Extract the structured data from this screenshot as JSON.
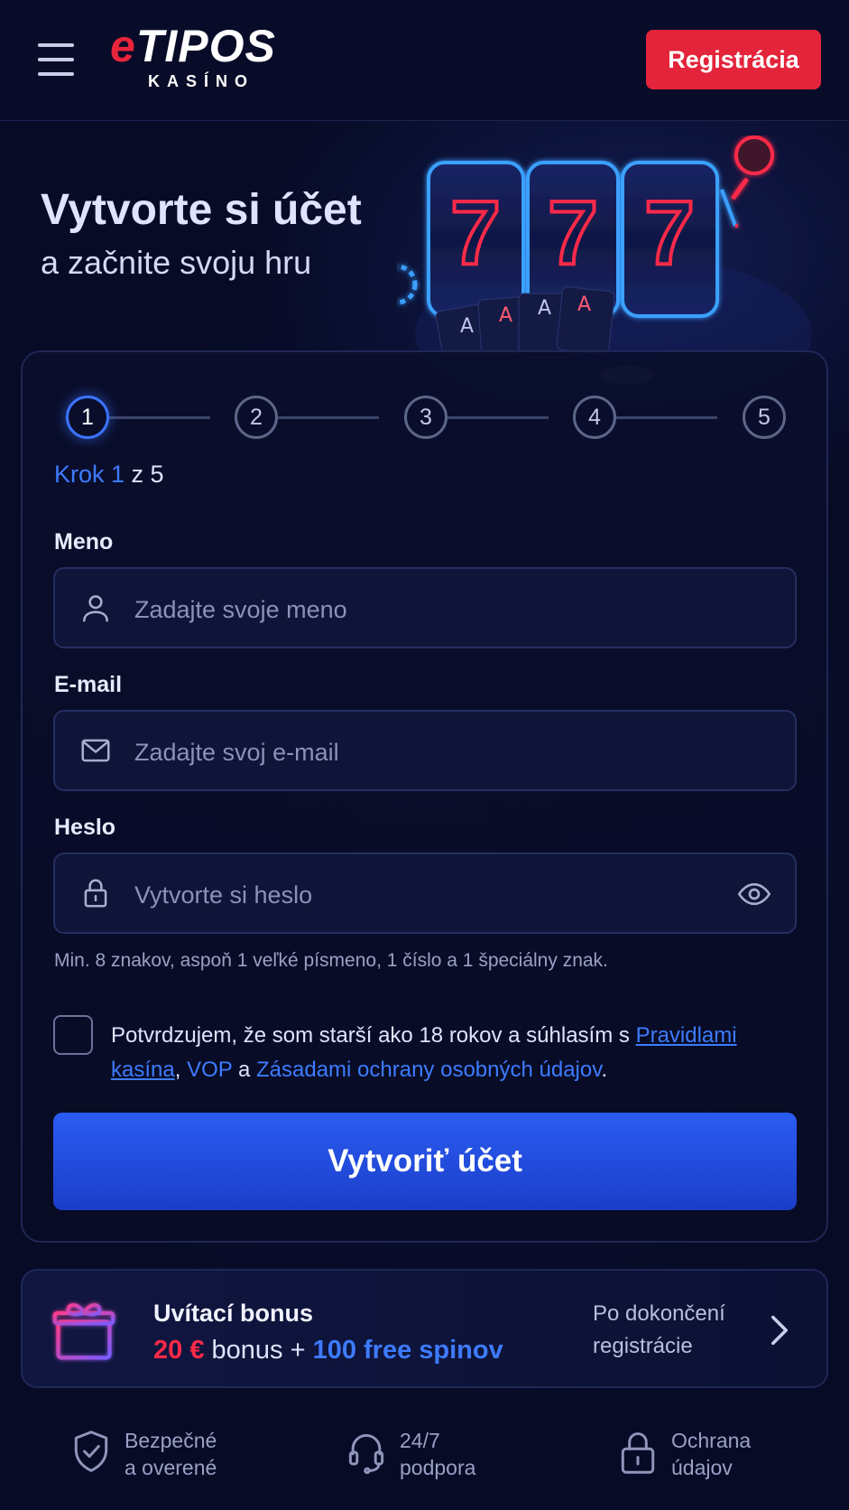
{
  "header": {
    "logo_main": "TIPOS",
    "logo_prefix": "e",
    "logo_sub": "KASÍNO",
    "register_label": "Registrácia"
  },
  "hero": {
    "title": "Vytvorte si účet",
    "subtitle": "a začnite svoju hru"
  },
  "stepper": {
    "steps": [
      "1",
      "2",
      "3",
      "4",
      "5"
    ],
    "current": 1,
    "label_prefix": "Krok 1",
    "label_suffix": " z 5"
  },
  "form": {
    "name_label": "Meno",
    "name_placeholder": "Zadajte svoje meno",
    "email_label": "E-mail",
    "email_placeholder": "Zadajte svoj e-mail",
    "password_label": "Heslo",
    "password_placeholder": "Vytvorte si heslo",
    "password_hint": "Min. 8 znakov, aspoň 1 veľké písmeno, 1 číslo a 1 špeciálny znak.",
    "consent_text": "Potvrdzujem, že som starší ako 18 rokov a súhlasím s ",
    "consent_link1": "Pravidlami kasína",
    "consent_sep1": ", ",
    "consent_link2": "VOP",
    "consent_sep2": " a ",
    "consent_link3": "Zásadami ochrany osobných údajov",
    "consent_end": ".",
    "submit_label": "Vytvoriť účet"
  },
  "bonus": {
    "title": "Uvítací bonus",
    "amount": "20 €",
    "mid": " bonus + ",
    "spins": "100 free spinov",
    "note": "Po dokončení registrácie"
  },
  "footer": {
    "badges": [
      {
        "icon": "shield-check-icon",
        "line1": "Bezpečné",
        "line2": "a overené"
      },
      {
        "icon": "headset-icon",
        "line1": "24/7",
        "line2": "podpora"
      },
      {
        "icon": "lock-icon",
        "line1": "Ochrana",
        "line2": "údajov"
      }
    ]
  },
  "colors": {
    "background": "#070b26",
    "accent_blue": "#3d7bff",
    "brand_red": "#e3243a"
  }
}
